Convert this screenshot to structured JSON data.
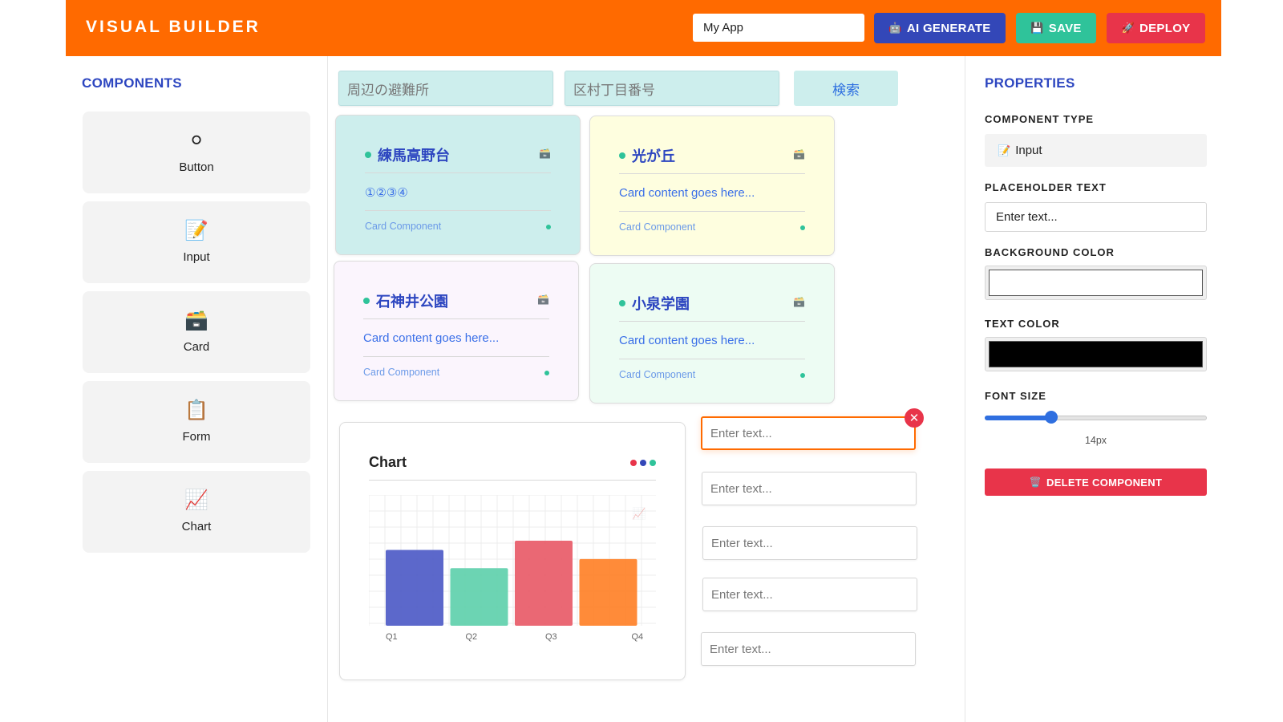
{
  "header": {
    "brand": "VISUAL BUILDER",
    "app_name_value": "My App",
    "ai_label": "AI GENERATE",
    "save_label": "SAVE",
    "deploy_label": "DEPLOY",
    "ai_icon": "🤖",
    "save_icon": "💾",
    "deploy_icon": "🚀"
  },
  "left": {
    "title": "COMPONENTS",
    "items": [
      {
        "label": "Button",
        "icon": "⚪"
      },
      {
        "label": "Input",
        "icon": "📝"
      },
      {
        "label": "Card",
        "icon": "🗃️"
      },
      {
        "label": "Form",
        "icon": "📋"
      },
      {
        "label": "Chart",
        "icon": "📈"
      }
    ]
  },
  "canvas": {
    "search_placeholder_1": "周辺の避難所",
    "search_placeholder_2": "区村丁目番号",
    "search_button": "検索",
    "cards": [
      {
        "title": "練馬高野台",
        "content": "①②③④",
        "footer": "Card Component",
        "icon": "🗃️",
        "bg": "#cdeeed"
      },
      {
        "title": "光が丘",
        "content": "Card content goes here...",
        "footer": "Card Component",
        "icon": "🗃️",
        "bg": "#fefedf"
      },
      {
        "title": "石神井公園",
        "content": "Card content goes here...",
        "footer": "Card Component",
        "icon": "🗃️",
        "bg": "#fbf5fd"
      },
      {
        "title": "小泉学園",
        "content": "Card content goes here...",
        "footer": "Card Component",
        "icon": "🗃️",
        "bg": "#edfcf3"
      }
    ],
    "chart_card": {
      "title": "Chart",
      "icon": "📈"
    },
    "inputs": [
      "Enter text...",
      "Enter text...",
      "Enter text...",
      "Enter text...",
      "Enter text..."
    ],
    "close_glyph": "✕"
  },
  "chart_data": {
    "type": "bar",
    "categories": [
      "Q1",
      "Q2",
      "Q3",
      "Q4"
    ],
    "values": [
      58,
      44,
      65,
      51
    ],
    "colors": [
      "#4e5bc7",
      "#5fd0ad",
      "#e85b68",
      "#ff8128"
    ],
    "ylim": [
      0,
      100
    ],
    "grid": true,
    "title": "",
    "xlabel": "",
    "ylabel": ""
  },
  "right": {
    "title": "PROPERTIES",
    "type_label": "COMPONENT TYPE",
    "type_value": "Input",
    "type_icon": "📝",
    "placeholder_label": "PLACEHOLDER TEXT",
    "placeholder_value": "Enter text...",
    "bg_label": "BACKGROUND COLOR",
    "bg_value": "#ffffff",
    "text_label": "TEXT COLOR",
    "text_value": "#000000",
    "font_label": "FONT SIZE",
    "font_value": "14px",
    "font_slider_fraction": 0.3,
    "delete_label": "DELETE COMPONENT",
    "delete_icon": "🗑️"
  },
  "colors": {
    "header_bg": "#ff6a00",
    "accent_blue": "#2d46c0",
    "ai_button": "#3347b8",
    "save_button": "#2fc39a",
    "deploy_button": "#e8344a"
  }
}
